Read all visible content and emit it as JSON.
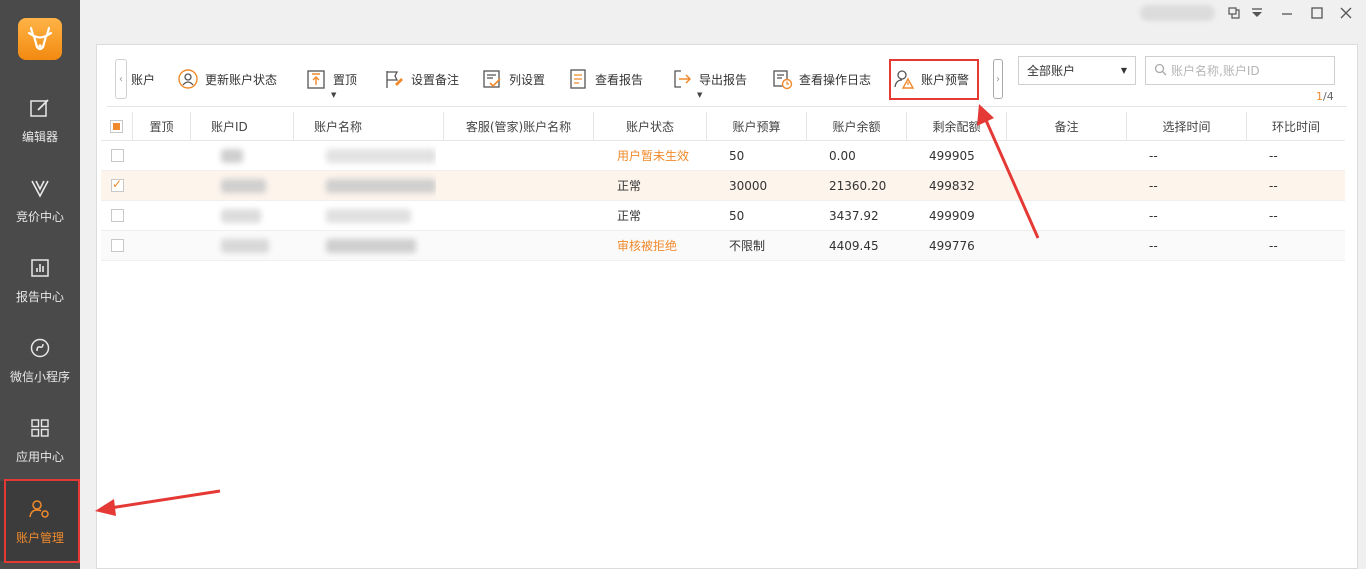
{
  "sidebar": {
    "items": [
      {
        "label": "编辑器",
        "icon": "edit-icon"
      },
      {
        "label": "竞价中心",
        "icon": "bid-icon"
      },
      {
        "label": "报告中心",
        "icon": "report-icon"
      },
      {
        "label": "微信小程序",
        "icon": "miniprogram-icon"
      },
      {
        "label": "应用中心",
        "icon": "apps-icon"
      },
      {
        "label": "账户管理",
        "icon": "account-settings-icon"
      }
    ],
    "active_index": 5
  },
  "toolbar": {
    "items": [
      {
        "label": "账户"
      },
      {
        "label": "更新账户状态"
      },
      {
        "label": "置顶"
      },
      {
        "label": "设置备注"
      },
      {
        "label": "列设置"
      },
      {
        "label": "查看报告"
      },
      {
        "label": "导出报告"
      },
      {
        "label": "查看操作日志"
      },
      {
        "label": "账户预警"
      }
    ]
  },
  "filter": {
    "account_select": "全部账户",
    "search_placeholder": "账户名称,账户ID",
    "page_current": "1",
    "page_total": "/4"
  },
  "table": {
    "columns": [
      "置顶",
      "账户ID",
      "账户名称",
      "客服(管家)账户名称",
      "账户状态",
      "账户预算",
      "账户余额",
      "剩余配额",
      "备注",
      "选择时间",
      "环比时间"
    ],
    "rows": [
      {
        "status": "用户暂未生效",
        "budget": "50",
        "balance": "0.00",
        "quota": "499905",
        "note": "",
        "select_time": "--",
        "compare_time": "--",
        "checked": false,
        "error": true
      },
      {
        "status": "正常",
        "budget": "30000",
        "balance": "21360.20",
        "quota": "499832",
        "note": "",
        "select_time": "--",
        "compare_time": "--",
        "checked": true,
        "error": false
      },
      {
        "status": "正常",
        "budget": "50",
        "balance": "3437.92",
        "quota": "499909",
        "note": "",
        "select_time": "--",
        "compare_time": "--",
        "checked": false,
        "error": false
      },
      {
        "status": "审核被拒绝",
        "budget": "不限制",
        "balance": "4409.45",
        "quota": "499776",
        "note": "",
        "select_time": "--",
        "compare_time": "--",
        "checked": false,
        "error": true
      }
    ]
  },
  "colors": {
    "accent": "#f08a2c",
    "annotation": "#e53935",
    "sidebar": "#4a4a4a"
  }
}
